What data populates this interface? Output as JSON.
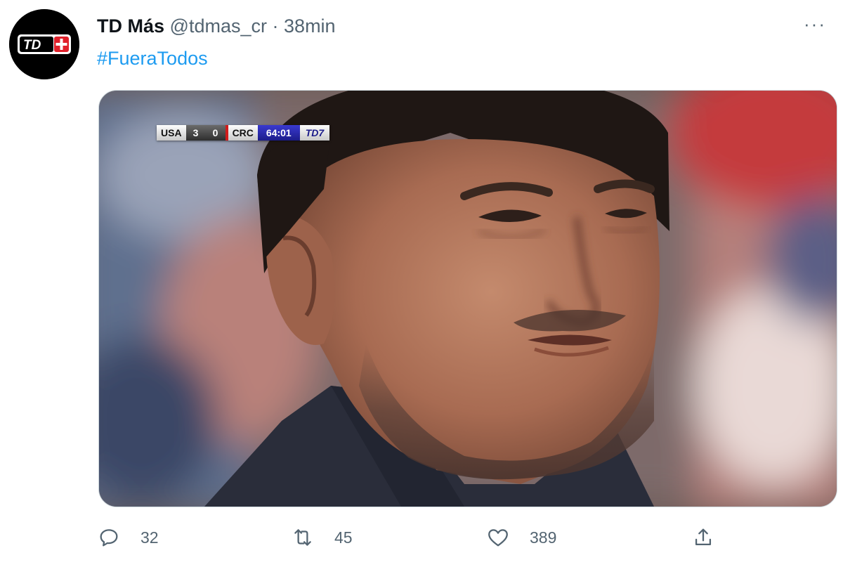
{
  "tweet": {
    "author": {
      "name": "TD Más",
      "handle": "@tdmas_cr",
      "avatar_logo_text": "TD+"
    },
    "separator": "·",
    "time": "38min",
    "more_label": "···",
    "text": "#FueraTodos",
    "media": {
      "scorebug": {
        "home_team": "USA",
        "home_score": "3",
        "away_score": "0",
        "away_team": "CRC",
        "clock": "64:01",
        "channel_logo": "TD7"
      }
    },
    "actions": {
      "replies": "32",
      "retweets": "45",
      "likes": "389"
    }
  },
  "colors": {
    "accent": "#1d9bf0",
    "secondary_text": "#536471",
    "brand_red": "#e0202a"
  }
}
